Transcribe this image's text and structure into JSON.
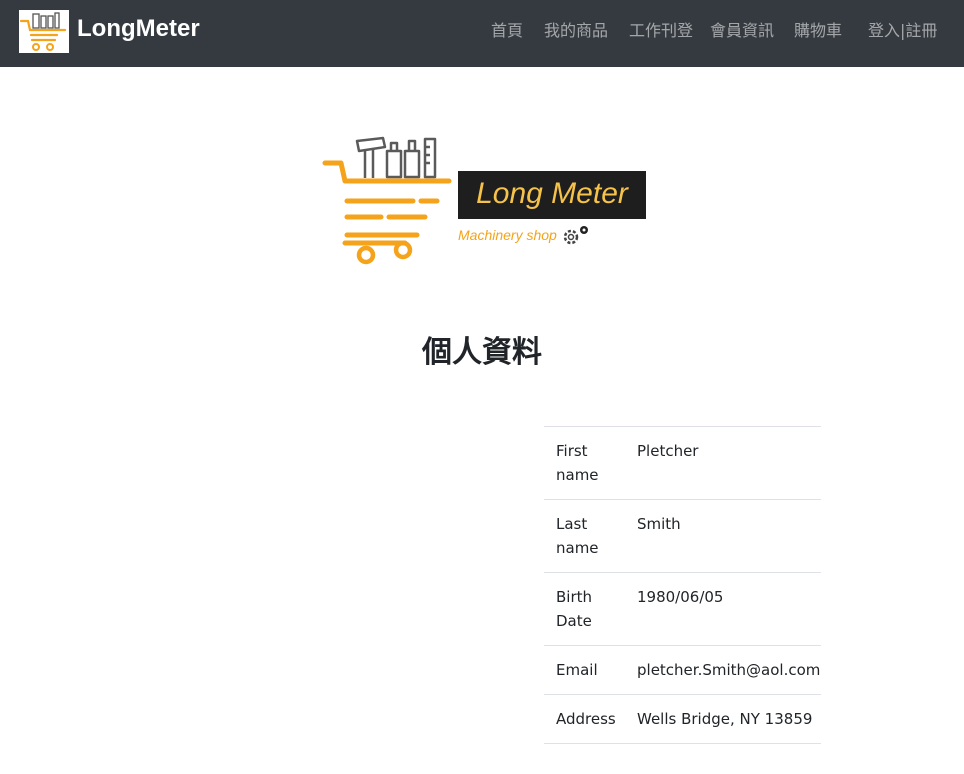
{
  "navbar": {
    "brand": "LongMeter",
    "items": [
      {
        "label": "首頁"
      },
      {
        "label": "我的商品"
      },
      {
        "label": "工作刊登"
      },
      {
        "label": "會員資訊"
      },
      {
        "label": "購物車"
      },
      {
        "label": "登入|註冊"
      }
    ]
  },
  "logo": {
    "title": "Long Meter",
    "subtitle": "Machinery shop",
    "accent_color": "#f5a31a",
    "box_color": "#1e1e1e",
    "icon": "shopping-cart-tools-gear-icon"
  },
  "page_title": "個人資料",
  "profile": {
    "rows": [
      {
        "label": "First name",
        "value": "Pletcher"
      },
      {
        "label": "Last name",
        "value": "Smith"
      },
      {
        "label": "Birth Date",
        "value": "1980/06/05"
      },
      {
        "label": "Email",
        "value": "pletcher.Smith@aol.com"
      },
      {
        "label": "Address",
        "value": "Wells Bridge, NY 13859"
      }
    ]
  }
}
